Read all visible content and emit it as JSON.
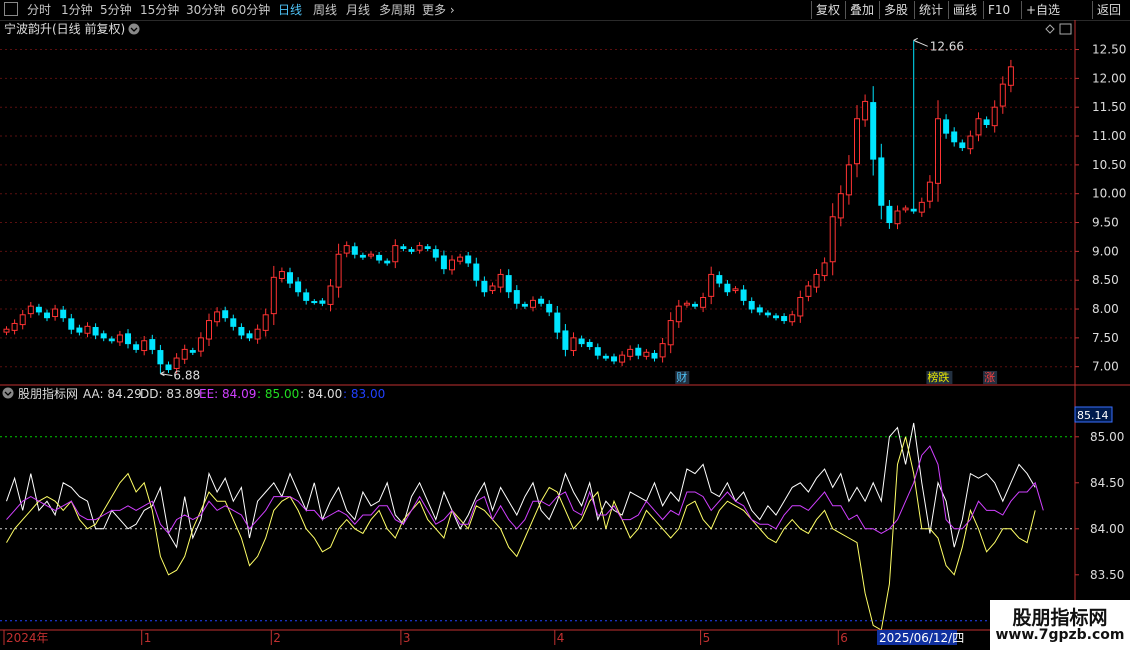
{
  "toolbar": {
    "periods": [
      "分时",
      "1分钟",
      "5分钟",
      "15分钟",
      "30分钟",
      "60分钟",
      "日线",
      "周线",
      "月线",
      "多周期",
      "更多"
    ],
    "active_period": "日线",
    "right_buttons": [
      "复权",
      "叠加",
      "多股",
      "统计",
      "画线",
      "F10",
      "+自选",
      "返回"
    ]
  },
  "stock_title": "宁波韵升(日线 前复权)",
  "indicator": {
    "name": "股朋指标网",
    "AA_label": "AA:",
    "AA": "84.29",
    "DD_label": "DD:",
    "DD": "83.89",
    "EE_label": "EE:",
    "EE": "84.09",
    "L1": ": 85.00",
    "L2": ": 84.00",
    "L3": ": 83.00",
    "current_label": "85.14"
  },
  "events": [
    {
      "text": "财",
      "color": "#4fc3f7",
      "index": 83
    },
    {
      "text": "榜跌",
      "color": "#e6e600",
      "index": 114
    },
    {
      "text": "涨",
      "color": "#ff4040",
      "index": 121
    }
  ],
  "x_axis": {
    "labels": [
      {
        "text": "2024年",
        "index": 0
      },
      {
        "text": "1",
        "index": 17
      },
      {
        "text": "2",
        "index": 33
      },
      {
        "text": "3",
        "index": 49
      },
      {
        "text": "4",
        "index": 68
      },
      {
        "text": "5",
        "index": 86
      },
      {
        "text": "6",
        "index": 103
      }
    ],
    "cursor_label": "2025/06/12/四",
    "cursor_index": 110
  },
  "watermark": {
    "line1": "股朋指标网",
    "line2": "www.7gpzb.com"
  },
  "colors": {
    "up": "#ff3333",
    "down": "#00e5ff",
    "aa": "#ffffff",
    "dd": "#ffff66",
    "ee": "#d040ff"
  },
  "chart_data": [
    {
      "type": "candlestick",
      "ylim": [
        6.7,
        12.7
      ],
      "yticks": [
        "7.00",
        "7.50",
        "8.00",
        "8.50",
        "9.00",
        "9.50",
        "10.00",
        "10.50",
        "11.00",
        "11.50",
        "12.00",
        "12.50"
      ],
      "ytick_values": [
        7.0,
        7.5,
        8.0,
        8.5,
        9.0,
        9.5,
        10.0,
        10.5,
        11.0,
        11.5,
        12.0,
        12.5
      ],
      "high_annotation": {
        "text": "12.66",
        "value": 12.66,
        "index": 112
      },
      "low_annotation": {
        "text": "6.88",
        "value": 6.88,
        "index": 19
      },
      "closes": [
        7.65,
        7.75,
        7.9,
        8.05,
        7.95,
        7.85,
        8.0,
        7.85,
        7.65,
        7.6,
        7.7,
        7.55,
        7.5,
        7.45,
        7.55,
        7.4,
        7.3,
        7.45,
        7.3,
        7.05,
        6.95,
        7.15,
        7.3,
        7.25,
        7.5,
        7.8,
        7.95,
        7.85,
        7.7,
        7.55,
        7.5,
        7.65,
        7.9,
        8.55,
        8.65,
        8.45,
        8.3,
        8.15,
        8.12,
        8.1,
        8.4,
        8.95,
        9.1,
        8.95,
        8.9,
        8.95,
        8.85,
        8.8,
        9.1,
        9.05,
        9.0,
        9.1,
        9.05,
        8.9,
        8.7,
        8.85,
        8.9,
        8.8,
        8.5,
        8.3,
        8.4,
        8.6,
        8.3,
        8.1,
        8.05,
        8.15,
        8.1,
        7.95,
        7.6,
        7.3,
        7.5,
        7.4,
        7.35,
        7.2,
        7.15,
        7.1,
        7.2,
        7.3,
        7.2,
        7.25,
        7.15,
        7.4,
        7.8,
        8.05,
        8.1,
        8.05,
        8.2,
        8.6,
        8.45,
        8.3,
        8.35,
        8.15,
        8.0,
        7.95,
        7.9,
        7.85,
        7.8,
        7.9,
        8.2,
        8.4,
        8.6,
        8.8,
        9.6,
        10.0,
        10.5,
        11.3,
        11.6,
        10.6,
        9.8,
        9.5,
        9.7,
        9.75,
        9.7,
        9.85,
        10.2,
        11.3,
        11.05,
        10.9,
        10.8,
        11.0,
        11.3,
        11.2,
        11.5,
        11.9,
        12.2
      ]
    },
    {
      "type": "line",
      "ylim": [
        82.9,
        85.4
      ],
      "yticks": [
        "83.00",
        "83.50",
        "84.00",
        "84.50",
        "85.00"
      ],
      "ytick_values": [
        83.0,
        83.5,
        84.0,
        84.5,
        85.0
      ],
      "hlines": [
        {
          "value": 85.0,
          "color": "#00cc00"
        },
        {
          "value": 84.0,
          "color": "#d0d0d0"
        },
        {
          "value": 83.0,
          "color": "#2040ff"
        }
      ],
      "series": [
        {
          "name": "AA",
          "values": [
            84.3,
            84.55,
            84.2,
            84.6,
            84.2,
            84.3,
            84.15,
            84.5,
            84.45,
            84.35,
            84.3,
            84.0,
            84.0,
            84.2,
            84.1,
            84.0,
            84.05,
            84.2,
            84.25,
            84.45,
            83.95,
            83.8,
            84.35,
            83.9,
            84.1,
            84.6,
            84.4,
            84.55,
            84.3,
            84.45,
            83.9,
            84.3,
            84.4,
            84.5,
            84.35,
            84.6,
            84.4,
            84.2,
            84.5,
            84.1,
            84.3,
            84.45,
            84.2,
            84.1,
            84.4,
            84.25,
            84.3,
            84.5,
            84.15,
            84.05,
            84.35,
            84.5,
            84.3,
            84.1,
            84.4,
            84.2,
            84.0,
            84.15,
            84.35,
            84.5,
            84.2,
            84.45,
            84.3,
            84.15,
            84.35,
            84.5,
            84.2,
            84.1,
            84.3,
            84.6,
            84.4,
            84.25,
            84.5,
            84.1,
            84.3,
            84.2,
            84.15,
            84.4,
            84.35,
            84.3,
            84.5,
            84.25,
            84.4,
            84.3,
            84.65,
            84.6,
            84.7,
            84.4,
            84.35,
            84.5,
            84.3,
            84.4,
            84.2,
            84.1,
            84.25,
            84.15,
            84.3,
            84.45,
            84.5,
            84.4,
            84.55,
            84.65,
            84.45,
            84.6,
            84.3,
            84.45,
            84.3,
            84.5,
            84.3,
            85.0,
            85.1,
            84.7,
            85.15,
            84.5,
            83.95,
            84.5,
            84.3,
            83.8,
            84.1,
            84.6,
            84.55,
            84.6,
            84.5,
            84.3,
            84.5,
            84.7,
            84.6,
            84.45
          ]
        },
        {
          "name": "DD",
          "values": [
            83.85,
            84.0,
            84.1,
            84.2,
            84.3,
            84.35,
            84.3,
            84.2,
            84.3,
            84.1,
            84.0,
            84.05,
            84.2,
            84.35,
            84.5,
            84.6,
            84.4,
            84.5,
            84.2,
            83.7,
            83.5,
            83.55,
            83.7,
            84.0,
            84.2,
            84.4,
            84.3,
            84.3,
            84.1,
            83.9,
            83.6,
            83.7,
            83.9,
            84.2,
            84.3,
            84.35,
            84.2,
            84.0,
            83.9,
            83.75,
            83.8,
            84.0,
            84.1,
            84.0,
            83.95,
            84.1,
            84.2,
            84.0,
            83.9,
            84.1,
            84.2,
            84.3,
            84.1,
            84.0,
            83.9,
            84.2,
            84.1,
            84.0,
            84.25,
            84.2,
            84.1,
            84.0,
            83.8,
            83.7,
            83.9,
            84.1,
            84.3,
            84.45,
            84.4,
            84.2,
            84.0,
            84.1,
            84.3,
            84.4,
            84.0,
            84.3,
            84.1,
            83.9,
            84.0,
            84.2,
            84.1,
            84.0,
            83.9,
            84.0,
            84.25,
            84.3,
            84.1,
            84.0,
            84.2,
            84.3,
            84.25,
            84.2,
            84.1,
            84.0,
            83.9,
            83.85,
            84.0,
            84.1,
            84.0,
            83.95,
            84.1,
            84.2,
            84.0,
            83.95,
            83.9,
            83.85,
            83.3,
            82.95,
            82.9,
            83.4,
            84.7,
            85.0,
            84.6,
            84.0,
            84.0,
            83.9,
            83.6,
            83.5,
            83.8,
            84.2,
            84.0,
            83.75,
            83.85,
            84.0,
            84.0,
            83.9,
            83.85,
            84.2
          ]
        },
        {
          "name": "EE",
          "values": [
            84.1,
            84.2,
            84.3,
            84.35,
            84.3,
            84.25,
            84.2,
            84.25,
            84.3,
            84.15,
            84.1,
            84.1,
            84.15,
            84.2,
            84.2,
            84.25,
            84.2,
            84.25,
            84.3,
            84.05,
            83.95,
            84.1,
            84.15,
            84.1,
            84.15,
            84.3,
            84.2,
            84.25,
            84.2,
            84.15,
            84.0,
            84.1,
            84.2,
            84.35,
            84.35,
            84.35,
            84.3,
            84.2,
            84.2,
            84.1,
            84.15,
            84.2,
            84.15,
            84.05,
            84.15,
            84.15,
            84.25,
            84.25,
            84.1,
            84.05,
            84.2,
            84.35,
            84.2,
            84.05,
            84.1,
            84.2,
            84.05,
            84.05,
            84.3,
            84.35,
            84.1,
            84.25,
            84.1,
            84.0,
            84.1,
            84.3,
            84.3,
            84.25,
            84.35,
            84.4,
            84.2,
            84.15,
            84.4,
            84.15,
            84.15,
            84.25,
            84.1,
            84.1,
            84.15,
            84.3,
            84.2,
            84.1,
            84.2,
            84.15,
            84.4,
            84.4,
            84.35,
            84.2,
            84.3,
            84.4,
            84.3,
            84.25,
            84.1,
            84.05,
            84.05,
            84.0,
            84.15,
            84.25,
            84.25,
            84.2,
            84.3,
            84.4,
            84.25,
            84.25,
            84.1,
            84.15,
            84.0,
            84.0,
            83.95,
            84.0,
            84.1,
            84.3,
            84.5,
            84.8,
            84.9,
            84.7,
            84.1,
            84.0,
            84.0,
            84.1,
            84.3,
            84.2,
            84.2,
            84.15,
            84.3,
            84.4,
            84.4,
            84.5,
            84.2
          ]
        }
      ]
    }
  ]
}
